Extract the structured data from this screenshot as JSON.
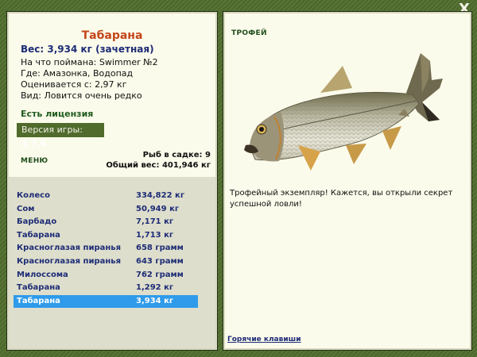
{
  "window": {
    "close_label": "X"
  },
  "catch": {
    "title": "Табарана",
    "weight": "Вес: 3,934 кг (зачетная)",
    "bait": "На что поймана: Swimmer №2",
    "location": "Где: Амазонка, Водопад",
    "price": "Оценивается с: 2,97 кг",
    "kind": "Вид: Ловится очень редко"
  },
  "license": {
    "label": "Есть лицензия"
  },
  "version": {
    "prefix": "Версия игры:",
    "value": "3.7.6"
  },
  "menu": {
    "tab_label": "МЕНЮ"
  },
  "keepnet": {
    "count_line": "Рыб в садке: 9",
    "total_line": "Общий вес: 401,946 кг"
  },
  "fish_list": [
    {
      "name": "Колесо",
      "weight": "334,822 кг"
    },
    {
      "name": "Сом",
      "weight": "50,949 кг"
    },
    {
      "name": "Барбадо",
      "weight": "7,171 кг"
    },
    {
      "name": "Табарана",
      "weight": "1,713 кг"
    },
    {
      "name": "Красноглазая пиранья",
      "weight": "658 грамм"
    },
    {
      "name": "Красноглазая пиранья",
      "weight": "643 грамм"
    },
    {
      "name": "Милоссома",
      "weight": "762 грамм"
    },
    {
      "name": "Табарана",
      "weight": "1,292 кг"
    },
    {
      "name": "Табарана",
      "weight": "3,934 кг",
      "selected": true
    }
  ],
  "trophy": {
    "tab_label": "ТРОФЕЙ",
    "message": "Трофейный экземпляр! Кажется, вы открыли секрет успешной ловли!"
  },
  "footer": {
    "hotkeys_label": "Горячие клавиши"
  },
  "colors": {
    "frame": "#4f6b2f",
    "panel": "#fbfbeb",
    "title": "#c4471b",
    "accent_blue": "#1d2c76",
    "selection": "#2f9bea"
  }
}
